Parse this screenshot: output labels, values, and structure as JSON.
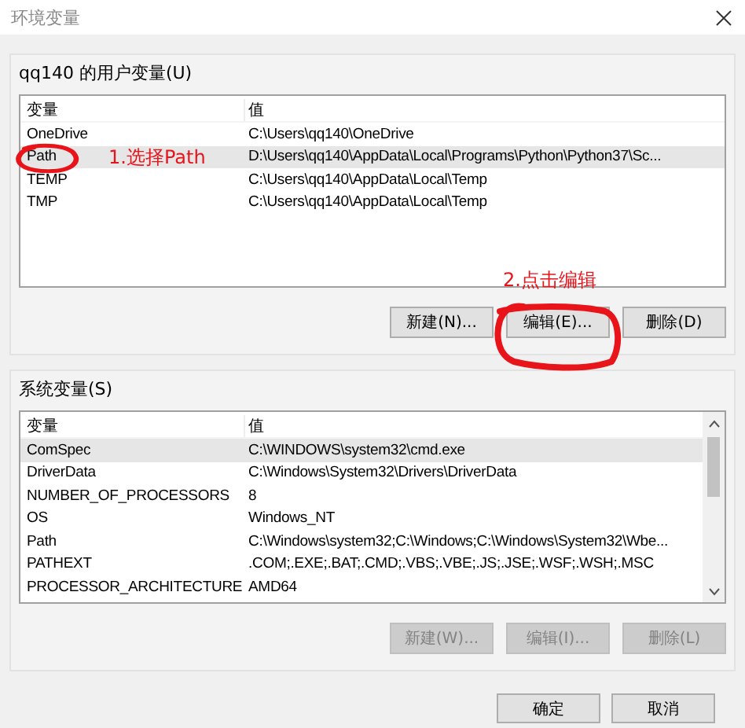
{
  "window": {
    "title": "环境变量"
  },
  "user_variables": {
    "label": "qq140 的用户变量(U)",
    "columns": [
      "变量",
      "值"
    ],
    "rows": [
      {
        "name": "OneDrive",
        "value": "C:\\Users\\qq140\\OneDrive",
        "selected": false
      },
      {
        "name": "Path",
        "value": "D:\\Users\\qq140\\AppData\\Local\\Programs\\Python\\Python37\\Sc...",
        "selected": true
      },
      {
        "name": "TEMP",
        "value": "C:\\Users\\qq140\\AppData\\Local\\Temp",
        "selected": false
      },
      {
        "name": "TMP",
        "value": "C:\\Users\\qq140\\AppData\\Local\\Temp",
        "selected": false
      }
    ],
    "buttons": [
      {
        "label": "新建(N)...",
        "disabled": false
      },
      {
        "label": "编辑(E)...",
        "disabled": false
      },
      {
        "label": "删除(D)",
        "disabled": false
      }
    ]
  },
  "system_variables": {
    "label": "系统变量(S)",
    "columns": [
      "变量",
      "值"
    ],
    "rows": [
      {
        "name": "ComSpec",
        "value": "C:\\WINDOWS\\system32\\cmd.exe",
        "selected": true
      },
      {
        "name": "DriverData",
        "value": "C:\\Windows\\System32\\Drivers\\DriverData",
        "selected": false
      },
      {
        "name": "NUMBER_OF_PROCESSORS",
        "value": "8",
        "selected": false
      },
      {
        "name": "OS",
        "value": "Windows_NT",
        "selected": false
      },
      {
        "name": "Path",
        "value": "C:\\Windows\\system32;C:\\Windows;C:\\Windows\\System32\\Wbe...",
        "selected": false
      },
      {
        "name": "PATHEXT",
        "value": ".COM;.EXE;.BAT;.CMD;.VBS;.VBE;.JS;.JSE;.WSF;.WSH;.MSC",
        "selected": false
      },
      {
        "name": "PROCESSOR_ARCHITECTURE",
        "value": "AMD64",
        "selected": false
      }
    ],
    "buttons": [
      {
        "label": "新建(W)...",
        "disabled": true
      },
      {
        "label": "编辑(I)...",
        "disabled": true
      },
      {
        "label": "删除(L)",
        "disabled": true
      }
    ]
  },
  "footer_buttons": [
    {
      "label": "确定"
    },
    {
      "label": "取消"
    }
  ],
  "annotations": [
    {
      "text": "1.选择Path"
    },
    {
      "text": "2.点击编辑"
    }
  ]
}
